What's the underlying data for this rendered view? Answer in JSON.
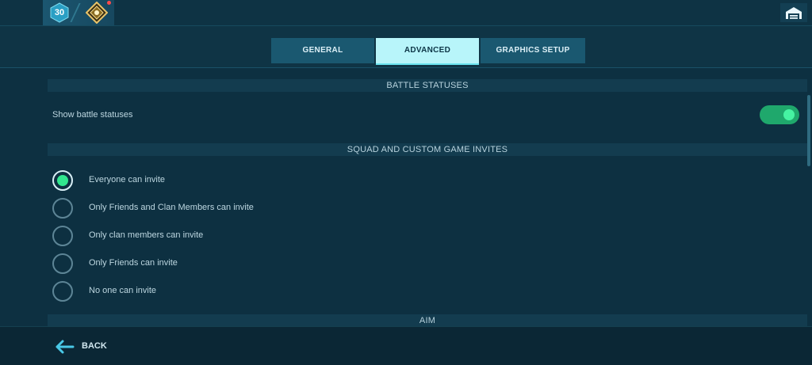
{
  "topbar": {
    "level": "30",
    "colors": {
      "level_badge": "#2a9fc4",
      "rank_icon_gold": "#e9c46a",
      "notify_dot": "#ff4b4b"
    }
  },
  "tabs": [
    {
      "label": "GENERAL",
      "active": false
    },
    {
      "label": "ADVANCED",
      "active": true
    },
    {
      "label": "GRAPHICS SETUP",
      "active": false
    }
  ],
  "battle_statuses": {
    "header": "BATTLE STATUSES",
    "show_label": "Show battle statuses",
    "toggle_on": true
  },
  "invites": {
    "header": "SQUAD AND CUSTOM GAME INVITES",
    "options": [
      {
        "label": "Everyone can invite",
        "selected": true
      },
      {
        "label": "Only Friends and Clan Members can invite",
        "selected": false
      },
      {
        "label": "Only clan members can invite",
        "selected": false
      },
      {
        "label": "Only Friends can invite",
        "selected": false
      },
      {
        "label": "No one can invite",
        "selected": false
      }
    ]
  },
  "aim": {
    "header": "AIM"
  },
  "footer": {
    "back_label": "BACK"
  },
  "colors": {
    "toggle_on": "#1fa86c",
    "radio_selected": "#31e68e",
    "active_tab": "#b8f5fa",
    "inactive_tab": "#1a5870"
  },
  "icons": {
    "level": "hexagon-level-icon",
    "rank": "rank-emblem-icon",
    "hangar": "hangar-icon",
    "back": "arrow-left-icon"
  }
}
